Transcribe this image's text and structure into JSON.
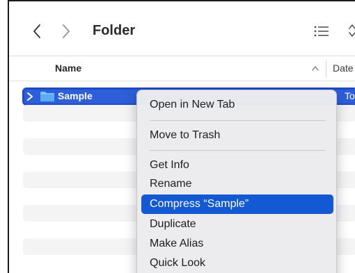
{
  "window": {
    "title": "Folder"
  },
  "toolbar": {
    "back_icon": "chevron-left-icon",
    "forward_icon": "chevron-right-icon",
    "view_icon": "list-view-icon",
    "view_chevron_icon": "up-down-chevron-icon"
  },
  "columns": {
    "name": "Name",
    "date": "Date"
  },
  "rows": [
    {
      "label": "Sample",
      "date": "Toda",
      "selected": true
    }
  ],
  "context_menu": {
    "items": [
      {
        "label": "Open in New Tab"
      },
      {
        "label": "Move to Trash"
      },
      {
        "label": "Get Info"
      },
      {
        "label": "Rename"
      },
      {
        "label": "Compress “Sample”",
        "highlighted": true
      },
      {
        "label": "Duplicate"
      },
      {
        "label": "Make Alias"
      },
      {
        "label": "Quick Look"
      }
    ]
  },
  "colors": {
    "selection": "#2e5fd9",
    "menu_highlight": "#1459d4"
  }
}
